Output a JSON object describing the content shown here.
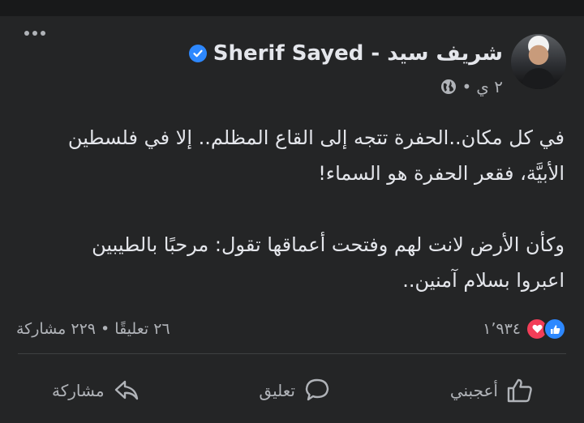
{
  "post": {
    "author": "Sherif Sayed - شريف سيد",
    "verified": true,
    "time": "٢ ي",
    "separator": "•",
    "audience_icon": "globe-icon",
    "text_lines": [
      "في كل مكان..الحفرة تتجه إلى القاع المظلم.. إلا في فلسطين",
      "الأبيَّة، فقعر الحفرة هو السماء!",
      "وكأن الأرض لانت لهم وفتحت أعماقها تقول:  مرحبًا بالطيبين",
      "اعبروا بسلام آمنين.."
    ]
  },
  "stats": {
    "reactions_count": "١٬٩٣٤",
    "comments_shares": "٢٦ تعليقًا • ٢٢٩ مشاركة"
  },
  "actions": {
    "like": "أعجبني",
    "comment": "تعليق",
    "share": "مشاركة"
  },
  "colors": {
    "background": "#18191a",
    "card": "#242526",
    "primary_text": "#e4e6eb",
    "secondary_text": "#b0b3b8",
    "accent": "#2d88ff",
    "love": "#f33e58"
  }
}
